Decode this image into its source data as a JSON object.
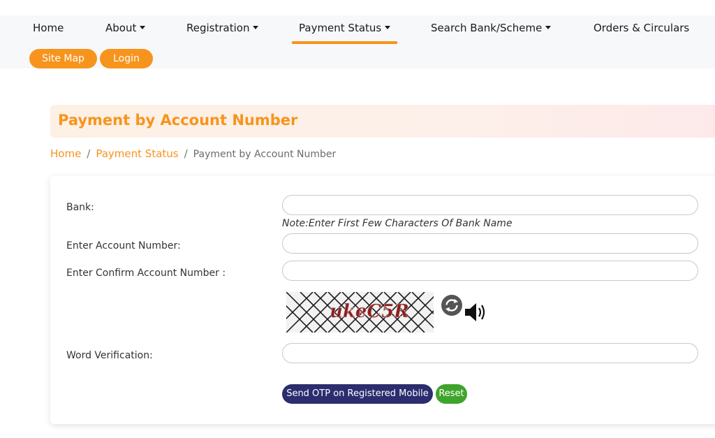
{
  "nav": {
    "items": [
      {
        "label": "Home",
        "dropdown": false
      },
      {
        "label": "About",
        "dropdown": true
      },
      {
        "label": "Registration",
        "dropdown": true
      },
      {
        "label": "Payment Status",
        "dropdown": true,
        "active": true
      },
      {
        "label": "Search Bank/Scheme",
        "dropdown": true
      },
      {
        "label": "Orders & Circulars",
        "dropdown": false
      }
    ],
    "buttons": {
      "site_map": "Site Map",
      "login": "Login"
    }
  },
  "page": {
    "title": "Payment by Account Number",
    "breadcrumb": {
      "home": "Home",
      "section": "Payment Status",
      "current": "Payment by Account Number",
      "separator": "/"
    }
  },
  "form": {
    "bank_label": "Bank:",
    "bank_value": "",
    "bank_note": "Note:Enter First Few Characters Of Bank Name",
    "account_label": "Enter Account Number:",
    "account_value": "",
    "confirm_label": "Enter Confirm Account Number :",
    "confirm_value": "",
    "captcha_text": "ukeC5R",
    "word_label": "Word Verification:",
    "word_value": "",
    "send_otp_label": "Send OTP on Registered Mobile No",
    "reset_label": "Reset"
  },
  "icons": {
    "caret": "chevron-down-icon",
    "refresh": "refresh-captcha-icon",
    "audio": "speaker-icon"
  },
  "colors": {
    "accent": "#f7941d",
    "primary_button": "#2b2d6e",
    "reset_button": "#3fa42b"
  }
}
